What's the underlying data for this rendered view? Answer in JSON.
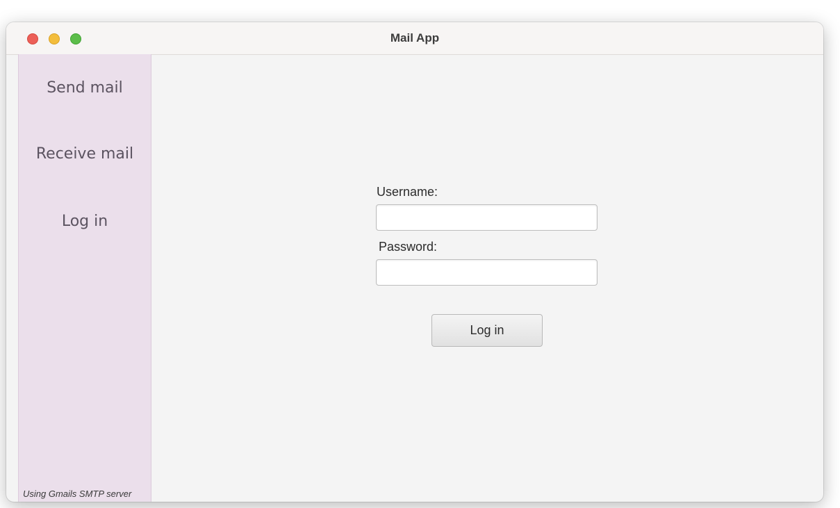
{
  "window": {
    "title": "Mail App"
  },
  "sidebar": {
    "items": [
      {
        "label": "Send mail"
      },
      {
        "label": "Receive mail"
      },
      {
        "label": "Log in"
      }
    ],
    "footer_note": "Using Gmails SMTP server"
  },
  "login_form": {
    "username_label": "Username:",
    "username_value": "",
    "password_label": "Password:",
    "password_value": "",
    "submit_label": "Log in"
  },
  "colors": {
    "sidebar_background": "#ebdfeb",
    "content_background": "#f4f4f4",
    "traffic_close": "#ec5f58",
    "traffic_minimize": "#f3bd3c",
    "traffic_zoom": "#5cbd4a"
  }
}
